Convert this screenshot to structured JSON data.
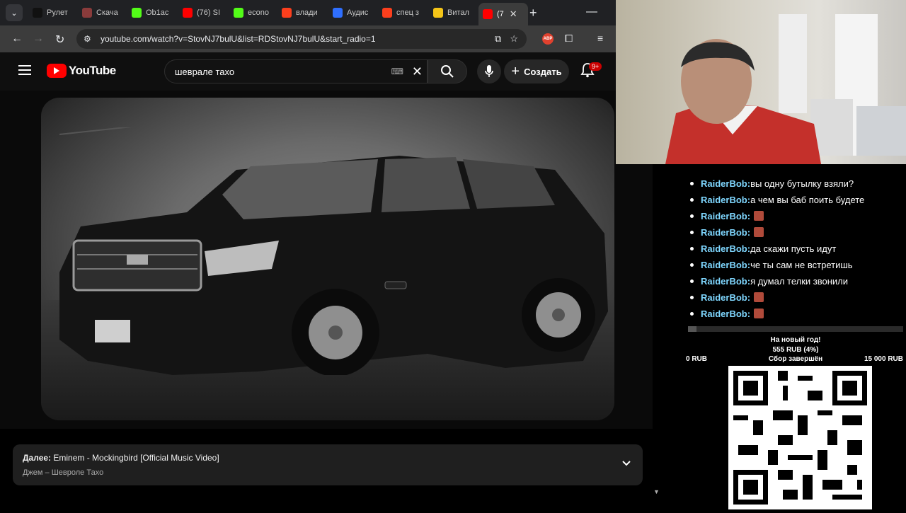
{
  "browser": {
    "tabs": [
      {
        "title": "Рулет",
        "icon": "tiktok-icon",
        "color": "#111111"
      },
      {
        "title": "Скача",
        "icon": "gift-icon",
        "color": "#8a3b3b"
      },
      {
        "title": "Ob1ac",
        "icon": "kick-icon",
        "color": "#53fc18"
      },
      {
        "title": "(76) SI",
        "icon": "youtube-icon",
        "color": "#ff0000"
      },
      {
        "title": "econo",
        "icon": "kick-icon",
        "color": "#53fc18"
      },
      {
        "title": "влади",
        "icon": "yandex-icon",
        "color": "#fc3f1d"
      },
      {
        "title": "Аудис",
        "icon": "pause-icon",
        "color": "#2f6fff"
      },
      {
        "title": "спец з",
        "icon": "yandex-icon",
        "color": "#fc3f1d"
      },
      {
        "title": "Витал",
        "icon": "play-icon",
        "color": "#f5c518"
      },
      {
        "title": "(7",
        "icon": "youtube-icon",
        "color": "#ff0000"
      }
    ],
    "url": "youtube.com/watch?v=StovNJ7bulU&list=RDStovNJ7bulU&start_radio=1",
    "abp_label": "ABP"
  },
  "youtube": {
    "logo_text": "YouTube",
    "search_query": "шевралe тахо",
    "create_label": "Создать",
    "notif_badge": "9+",
    "up_next": {
      "prefix": "Далее:",
      "title": "Eminem - Mockingbird [Official Music Video]",
      "subtitle": "Джем – Шевроле Тахо"
    }
  },
  "chat": {
    "messages": [
      {
        "nick": "RaiderBob:",
        "text": "вы одну бутылку взяли?",
        "emote": false
      },
      {
        "nick": "RaiderBob:",
        "text": "а чем вы баб поить будете",
        "emote": false
      },
      {
        "nick": "RaiderBob:",
        "text": "",
        "emote": true
      },
      {
        "nick": "RaiderBob:",
        "text": "",
        "emote": true
      },
      {
        "nick": "RaiderBob:",
        "text": "да скажи пусть идут",
        "emote": false
      },
      {
        "nick": "RaiderBob:",
        "text": "че ты сам не встретишь",
        "emote": false
      },
      {
        "nick": "RaiderBob:",
        "text": "я думал телки звонили",
        "emote": false
      },
      {
        "nick": "RaiderBob:",
        "text": "",
        "emote": true
      },
      {
        "nick": "RaiderBob:",
        "text": "",
        "emote": true
      }
    ]
  },
  "donation": {
    "title": "На новый год!",
    "amount": "555 RUB (4%)",
    "progress_percent": 4,
    "min": "0 RUB",
    "status": "Сбор завершён",
    "max": "15 000 RUB"
  }
}
